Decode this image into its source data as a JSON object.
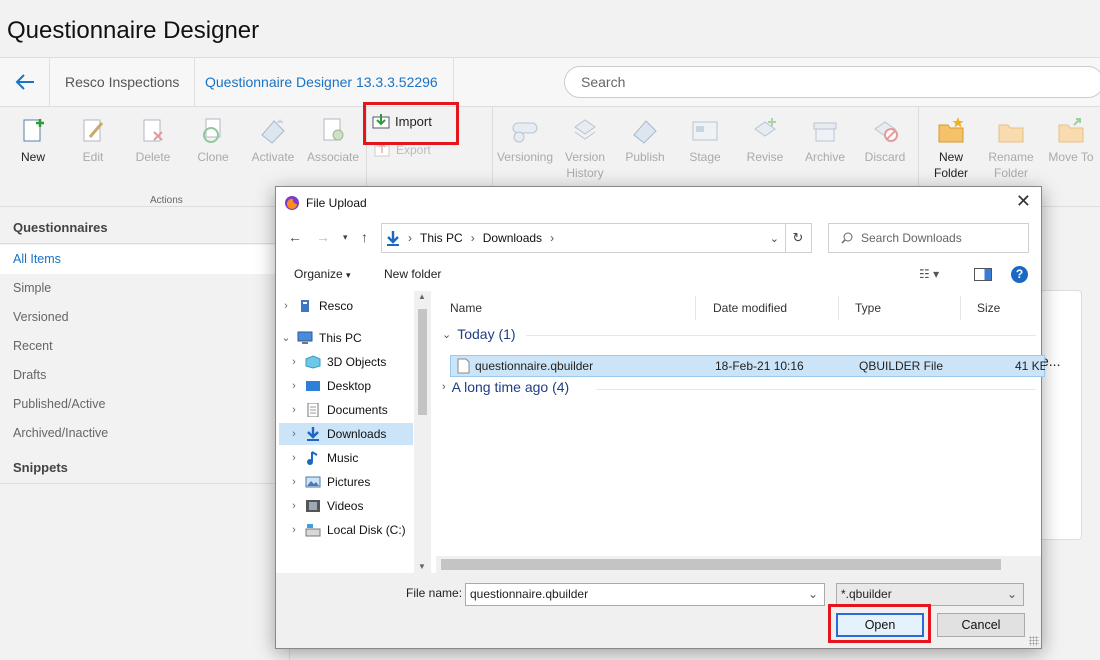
{
  "app": {
    "title": "Questionnaire Designer"
  },
  "nav": {
    "crumb_app": "Resco Inspections",
    "crumb_page": "Questionnaire Designer 13.3.3.52296",
    "search_placeholder": "Search"
  },
  "ribbon": {
    "buttons": [
      {
        "label": "New",
        "icon": "new-doc-icon"
      },
      {
        "label": "Edit",
        "icon": "edit-icon"
      },
      {
        "label": "Delete",
        "icon": "delete-icon"
      },
      {
        "label": "Clone",
        "icon": "clone-icon"
      },
      {
        "label": "Activate",
        "icon": "activate-icon"
      },
      {
        "label": "Associate",
        "icon": "associate-icon"
      }
    ],
    "group_label": "Actions",
    "import_label": "Import",
    "export_label": "Export",
    "version_buttons": [
      {
        "label": "Versioning"
      },
      {
        "label": "Version History"
      },
      {
        "label": "Publish"
      },
      {
        "label": "Stage"
      },
      {
        "label": "Revise"
      },
      {
        "label": "Archive"
      },
      {
        "label": "Discard"
      }
    ],
    "folder_buttons": [
      {
        "label": "New Folder"
      },
      {
        "label": "Rename Folder"
      },
      {
        "label": "Move To"
      }
    ]
  },
  "sidebar": {
    "questionnaires_header": "Questionnaires",
    "items": [
      "All Items",
      "Simple",
      "Versioned",
      "Recent",
      "Drafts",
      "Published/Active",
      "Archived/Inactive"
    ],
    "snippets_header": "Snippets"
  },
  "dialog": {
    "title": "File Upload",
    "path": [
      "This PC",
      "Downloads"
    ],
    "search_placeholder": "Search Downloads",
    "organize_label": "Organize",
    "new_folder_label": "New folder",
    "tree": [
      {
        "label": "Resco",
        "icon": "network-icon",
        "indent": 0
      },
      {
        "label": "This PC",
        "icon": "computer-icon",
        "indent": 0,
        "expanded": true
      },
      {
        "label": "3D Objects",
        "icon": "cube-icon",
        "indent": 1
      },
      {
        "label": "Desktop",
        "icon": "desktop-icon",
        "indent": 1
      },
      {
        "label": "Documents",
        "icon": "documents-icon",
        "indent": 1
      },
      {
        "label": "Downloads",
        "icon": "downloads-icon",
        "indent": 1,
        "selected": true
      },
      {
        "label": "Music",
        "icon": "music-icon",
        "indent": 1
      },
      {
        "label": "Pictures",
        "icon": "pictures-icon",
        "indent": 1
      },
      {
        "label": "Videos",
        "icon": "videos-icon",
        "indent": 1
      },
      {
        "label": "Local Disk (C:)",
        "icon": "disk-icon",
        "indent": 1
      }
    ],
    "columns": [
      "Name",
      "Date modified",
      "Type",
      "Size"
    ],
    "groups": [
      {
        "label": "Today (1)",
        "expanded": true
      },
      {
        "label": "A long time ago (4)",
        "expanded": false
      }
    ],
    "file": {
      "name": "questionnaire.qbuilder",
      "date": "18-Feb-21 10:16",
      "type": "QBUILDER File",
      "size": "41 KB"
    },
    "file_name_label": "File name:",
    "file_name_value": "questionnaire.qbuilder",
    "file_type_value": "*.qbuilder",
    "open_label": "Open",
    "cancel_label": "Cancel"
  },
  "background": {
    "card_text": "e..."
  }
}
